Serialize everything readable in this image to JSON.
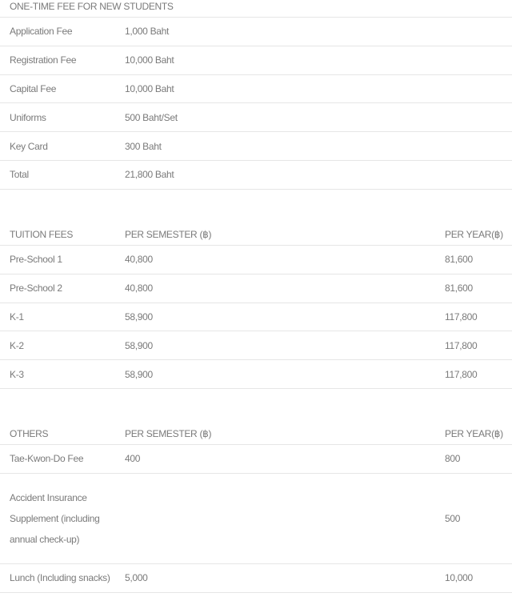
{
  "one_time": {
    "header": "ONE-TIME FEE FOR NEW STUDENTS",
    "rows": [
      {
        "label": "Application Fee",
        "value": "1,000 Baht"
      },
      {
        "label": "Registration Fee",
        "value": "10,000 Baht"
      },
      {
        "label": "Capital Fee",
        "value": "10,000 Baht"
      },
      {
        "label": "Uniforms",
        "value": "500 Baht/Set"
      },
      {
        "label": "Key Card",
        "value": "300 Baht"
      },
      {
        "label": "Total",
        "value": "21,800 Baht"
      }
    ]
  },
  "tuition": {
    "headers": [
      "TUITION FEES",
      "PER SEMESTER (฿)",
      "PER YEAR(฿)"
    ],
    "rows": [
      {
        "label": "Pre-School 1",
        "semester": "40,800",
        "year": "81,600"
      },
      {
        "label": "Pre-School 2",
        "semester": "40,800",
        "year": "81,600"
      },
      {
        "label": "K-1",
        "semester": "58,900",
        "year": "117,800"
      },
      {
        "label": "K-2",
        "semester": "58,900",
        "year": "117,800"
      },
      {
        "label": "K-3",
        "semester": "58,900",
        "year": "117,800"
      }
    ]
  },
  "others": {
    "headers": [
      "OTHERS",
      "PER SEMESTER (฿)",
      "PER YEAR(฿)"
    ],
    "rows": [
      {
        "label": "Tae-Kwon-Do Fee",
        "semester": "400",
        "year": "800"
      },
      {
        "label": "Accident Insurance Supplement (including annual check-up)",
        "semester": "",
        "year": "500"
      },
      {
        "label": "Lunch (Including snacks)",
        "semester": "5,000",
        "year": "10,000"
      }
    ]
  }
}
